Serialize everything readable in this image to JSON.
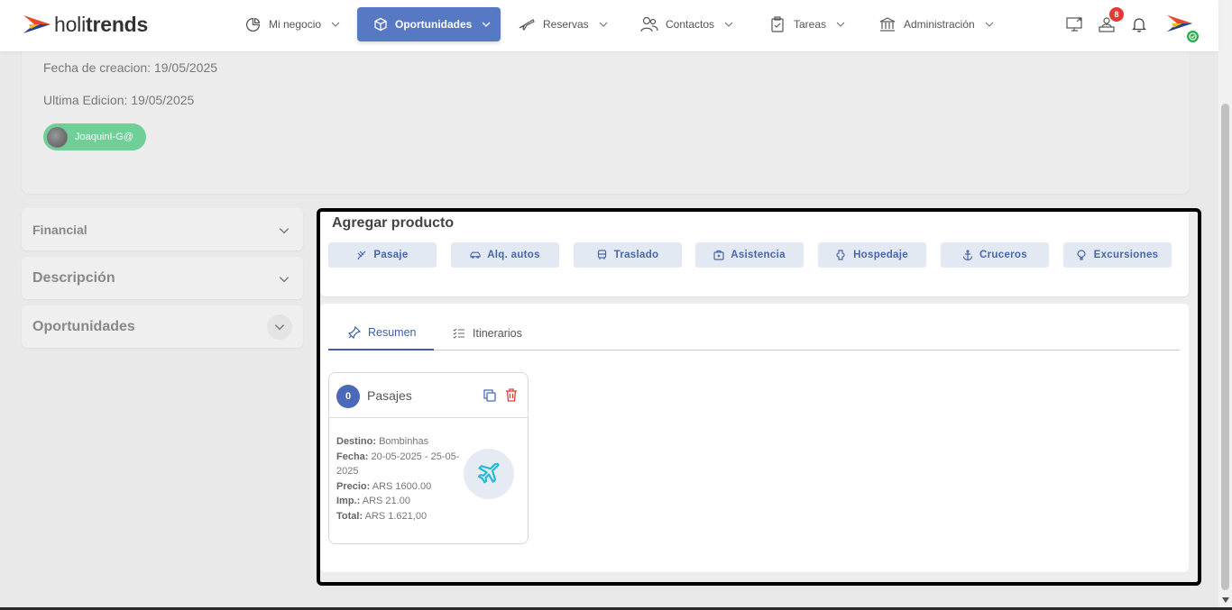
{
  "brand": {
    "logo_prefix": "holi",
    "logo_suffix": "trends"
  },
  "nav": {
    "items": [
      {
        "label": "Mi negocio",
        "icon": "pie-chart-icon"
      },
      {
        "label": "Oportunidades",
        "icon": "cube-icon",
        "active": true
      },
      {
        "label": "Reservas",
        "icon": "airplane-icon"
      },
      {
        "label": "Contactos",
        "icon": "users-icon"
      },
      {
        "label": "Tareas",
        "icon": "clipboard-check-icon"
      },
      {
        "label": "Administración",
        "icon": "bank-icon"
      }
    ],
    "notification_count": "8"
  },
  "info": {
    "created": "Fecha de creacion: 19/05/2025",
    "edited": "Ultima Edicion: 19/05/2025",
    "user": "JoaquinI-G@"
  },
  "accordion": {
    "financial": "Financial",
    "descripcion": "Descripción",
    "oportunidades": "Oportunidades"
  },
  "add_product": {
    "title": "Agregar producto",
    "buttons": [
      "Pasaje",
      "Alq. autos",
      "Traslado",
      "Asistencia",
      "Hospedaje",
      "Cruceros",
      "Excursiones"
    ]
  },
  "tabs": {
    "resumen": "Resumen",
    "itinerarios": "Itinerarios"
  },
  "product_card": {
    "count": "0",
    "title": "Pasajes",
    "destino_label": "Destino:",
    "destino": "Bombinhas",
    "fecha_label": "Fecha:",
    "fecha": "20-05-2025 - 25-05-2025",
    "precio_label": "Precio:",
    "precio": "ARS 1600.00",
    "imp_label": "Imp.:",
    "imp": "ARS 21.00",
    "total_label": "Total:",
    "total": "ARS 1.621,00"
  },
  "colors": {
    "primary": "#5779c4",
    "success": "#6fcf97",
    "danger": "#e53935",
    "accent_plane": "#1fb8d6"
  }
}
